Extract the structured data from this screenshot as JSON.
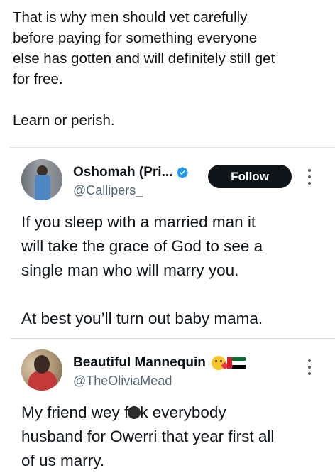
{
  "intro": {
    "line1": "That is why men should vet carefully",
    "line2": "before paying for something everyone",
    "line3": "else has gotten and will definitely still get",
    "line4": "for free.",
    "line5": "Learn or perish."
  },
  "tweet1": {
    "display_name": "Oshomah (Pri...",
    "handle": "@Callipers_",
    "follow_label": "Follow",
    "text_line1": "If you sleep with a married man it",
    "text_line2": "will take the grace of God to see a",
    "text_line3": "single man who will marry you.",
    "text_line4": "At best you’ll turn out baby mama."
  },
  "tweet2": {
    "display_name": "Beautiful Mannequin",
    "handle": "@TheOliviaMead",
    "text_line1_pre": "My friend wey f",
    "text_line1_post": "k everybody",
    "text_line2": "husband for Owerri that year first all",
    "text_line3": "of us marry."
  },
  "icons": {
    "verified": "verified-badge-icon",
    "more": "more-options-icon",
    "emoji_kiss": "face-blowing-kiss-emoji",
    "flag": "uae-flag-emoji"
  },
  "colors": {
    "follow_bg": "#0f1419",
    "verified": "#1d9bf0",
    "secondary_text": "#536471"
  }
}
